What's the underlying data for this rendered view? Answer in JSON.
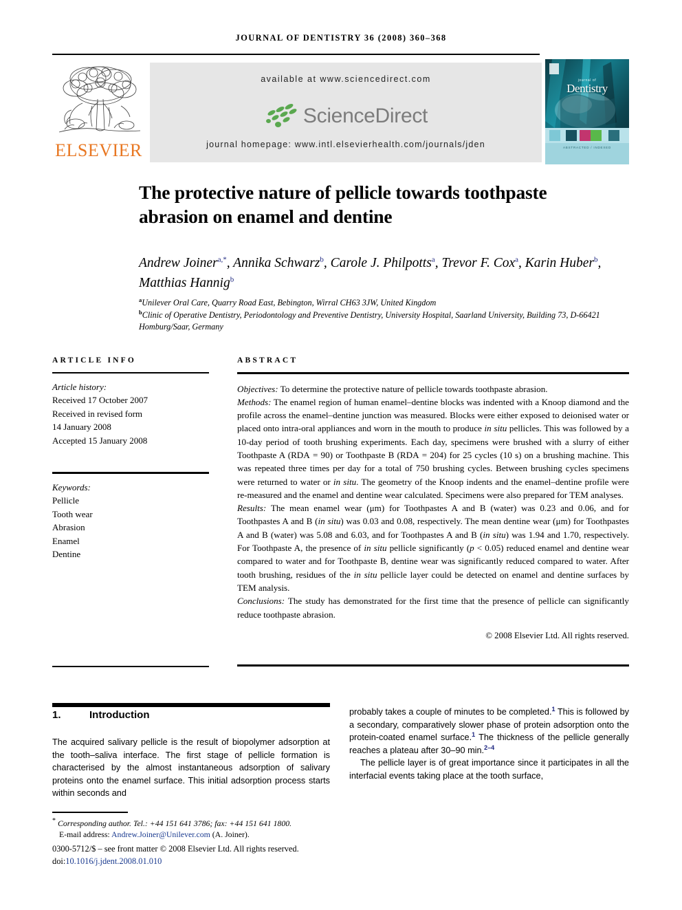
{
  "running_head": "JOURNAL OF DENTISTRY 36 (2008) 360–368",
  "masthead": {
    "publisher": "ELSEVIER",
    "available_at": "available at www.sciencedirect.com",
    "sciencedirect_wordmark": "ScienceDirect",
    "journal_homepage": "journal homepage: www.intl.elsevierhealth.com/journals/jden",
    "cover": {
      "kicker": "journal of",
      "title": "Dentistry",
      "footer_text": "ABSTRACTED / INDEXED"
    },
    "colors": {
      "elsevier_orange": "#E87722",
      "sciencedirect_green": "#5aa84f",
      "sciencedirect_gray": "#7c7c7c",
      "banner_gray": "#e6e6e6",
      "cover_teal": "#1b8f9e",
      "link_blue": "#1a3a8f"
    }
  },
  "article": {
    "title": "The protective nature of pellicle towards toothpaste abrasion on enamel and dentine",
    "authors_html": "Andrew Joiner<sup>a,*</sup>, Annika Schwarz<sup>b</sup>, Carole J. Philpotts<sup>a</sup>, Trevor F. Cox<sup>a</sup>, Karin Huber<sup>b</sup>, Matthias Hannig<sup>b</sup>",
    "affiliations_html": "<sup>a</sup>Unilever Oral Care, Quarry Road East, Bebington, Wirral CH63 3JW, United Kingdom<br><sup>b</sup>Clinic of Operative Dentistry, Periodontology and Preventive Dentistry, University Hospital, Saarland University, Building 73, D-66421 Homburg/Saar, Germany"
  },
  "article_info": {
    "heading": "ARTICLE INFO",
    "history_label": "Article history:",
    "history": [
      "Received 17 October 2007",
      "Received in revised form",
      "14 January 2008",
      "Accepted 15 January 2008"
    ],
    "keywords_label": "Keywords:",
    "keywords": [
      "Pellicle",
      "Tooth wear",
      "Abrasion",
      "Enamel",
      "Dentine"
    ]
  },
  "abstract": {
    "heading": "ABSTRACT",
    "objectives_label": "Objectives:",
    "objectives": "To determine the protective nature of pellicle towards toothpaste abrasion.",
    "methods_label": "Methods:",
    "methods_html": "The enamel region of human enamel–dentine blocks was indented with a Knoop diamond and the profile across the enamel–dentine junction was measured. Blocks were either exposed to deionised water or placed onto intra-oral appliances and worn in the mouth to produce <i>in situ</i> pellicles. This was followed by a 10-day period of tooth brushing experiments. Each day, specimens were brushed with a slurry of either Toothpaste A (RDA&nbsp;=&nbsp;90) or Toothpaste B (RDA&nbsp;=&nbsp;204) for 25 cycles (10&nbsp;s) on a brushing machine. This was repeated three times per day for a total of 750 brushing cycles. Between brushing cycles specimens were returned to water or <i>in situ</i>. The geometry of the Knoop indents and the enamel–dentine profile were re-measured and the enamel and dentine wear calculated. Specimens were also prepared for TEM analyses.",
    "results_label": "Results:",
    "results_html": "The mean enamel wear (μm) for Toothpastes A and B (water) was 0.23 and 0.06, and for Toothpastes A and B (<i>in situ</i>) was 0.03 and 0.08, respectively. The mean dentine wear (μm) for Toothpastes A and B (water) was 5.08 and 6.03, and for Toothpastes A and B (<i>in situ</i>) was 1.94 and 1.70, respectively. For Toothpaste A, the presence of <i>in situ</i> pellicle significantly (<i>p</i>&nbsp;&lt;&nbsp;0.05) reduced enamel and dentine wear compared to water and for Toothpaste B, dentine wear was significantly reduced compared to water. After tooth brushing, residues of the <i>in situ</i> pellicle layer could be detected on enamel and dentine surfaces by TEM analysis.",
    "conclusions_label": "Conclusions:",
    "conclusions": "The study has demonstrated for the first time that the presence of pellicle can significantly reduce toothpaste abrasion.",
    "copyright": "© 2008 Elsevier Ltd. All rights reserved."
  },
  "body": {
    "section_number": "1.",
    "section_title": "Introduction",
    "left_column_html": "The acquired salivary pellicle is the result of biopolymer adsorption at the tooth–saliva interface. The first stage of pellicle formation is characterised by the almost instantaneous adsorption of salivary proteins onto the enamel surface. This initial adsorption process starts within seconds and",
    "right_column_p1_html": "probably takes a couple of minutes to be completed.<sup>1</sup> This is followed by a secondary, comparatively slower phase of protein adsorption onto the protein-coated enamel surface.<sup>1</sup> The thickness of the pellicle generally reaches a plateau after 30–90&nbsp;min.<sup>2–4</sup>",
    "right_column_p2_html": "The pellicle layer is of great importance since it participates in all the interfacial events taking place at the tooth surface,"
  },
  "footer": {
    "corresponding_note": "Corresponding author. Tel.: +44 151 641 3786; fax: +44 151 641 1800.",
    "email_label": "E-mail address:",
    "email": "Andrew.Joiner@Unilever.com",
    "email_suffix": "(A. Joiner).",
    "front_matter": "0300-5712/$ – see front matter © 2008 Elsevier Ltd. All rights reserved.",
    "doi_label": "doi:",
    "doi": "10.1016/j.jdent.2008.01.010"
  }
}
